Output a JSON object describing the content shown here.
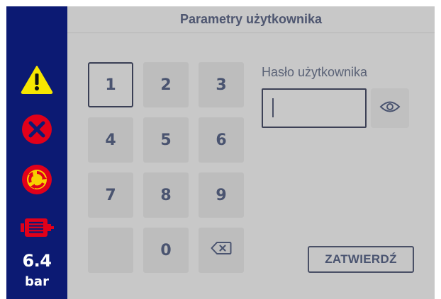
{
  "header": {
    "title": "Parametry użytkownika"
  },
  "sidebar": {
    "icons": [
      "warning-icon",
      "error-icon",
      "recirculation-icon",
      "motor-icon"
    ],
    "pressure": {
      "value": "6.4",
      "unit": "bar"
    },
    "colors": {
      "background": "#0c1a73",
      "warning": "#f7e600",
      "error": "#e1001a",
      "cycle": "#e1001a"
    }
  },
  "keypad": {
    "keys": [
      "1",
      "2",
      "3",
      "4",
      "5",
      "6",
      "7",
      "8",
      "9",
      "",
      "0",
      "backspace-icon"
    ],
    "focused_key": "1"
  },
  "password": {
    "label": "Hasło użytkownika",
    "value": "",
    "toggle_icon": "eye-icon"
  },
  "confirm": {
    "label": "ZATWIERDŹ"
  },
  "colors": {
    "panel": "#c8c8c8",
    "key": "#bdbdbd",
    "text": "#4a5470"
  }
}
